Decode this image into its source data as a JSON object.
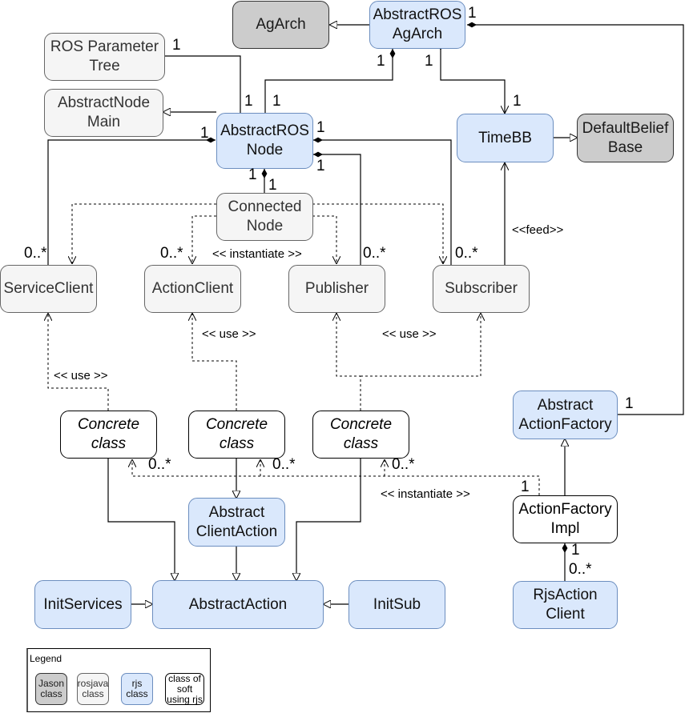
{
  "diagram": {
    "type": "uml-class-diagram",
    "colors": {
      "jason": "#cccccc",
      "rosjava": "#f5f5f5",
      "rjs": "#dae8fc",
      "soft": "#ffffff",
      "rjs_border": "#6c8ebf"
    },
    "nodes": {
      "agarch": "AgArch",
      "abstract_ros_agarch": "AbstractROS\nAgArch",
      "ros_parameter_tree": "ROS Parameter\nTree",
      "abstract_node_main": "AbstractNode\nMain",
      "abstract_ros_node": "AbstractROS\nNode",
      "timebb": "TimeBB",
      "default_belief_base": "DefaultBelief\nBase",
      "connected_node": "Connected\nNode",
      "service_client": "ServiceClient",
      "action_client": "ActionClient",
      "publisher": "Publisher",
      "subscriber": "Subscriber",
      "abstract_action_factory": "Abstract\nActionFactory",
      "concrete_class_1": "Concrete\nclass",
      "concrete_class_2": "Concrete\nclass",
      "concrete_class_3": "Concrete\nclass",
      "abstract_client_action": "Abstract\nClientAction",
      "action_factory_impl": "ActionFactory\nImpl",
      "init_services": "InitServices",
      "abstract_action": "AbstractAction",
      "init_sub": "InitSub",
      "rjs_action_client": "RjsAction\nClient"
    },
    "multiplicities": {
      "agarch_to_factory": "1",
      "agarch_node_comp": "1",
      "agarch_timebb": "1",
      "timebb_agarch": "1",
      "param_tree": "1",
      "node_param": "1",
      "node_agarch": "1",
      "node_service_client": "1",
      "node_subscriber": "1",
      "node_publisher": "1",
      "node_connected_a": "1",
      "node_connected_b": "1",
      "service_client_many": "0..*",
      "action_client_many": "0..*",
      "publisher_many": "0..*",
      "subscriber_many": "0..*",
      "factory_one": "1",
      "concrete1_many": "0..*",
      "concrete2_many": "0..*",
      "concrete3_many": "0..*",
      "impl_instantiate_one": "1",
      "impl_one": "1",
      "rjs_client_many": "0..*"
    },
    "stereotypes": {
      "instantiate_top": "<< instantiate >>",
      "feed": "<<feed>>",
      "use_action_client": "<< use >>",
      "use_pub_sub": "<< use >>",
      "use_service_client": "<< use >>",
      "instantiate_bottom": "<< instantiate >>"
    },
    "legend": {
      "title": "Legend",
      "items": [
        {
          "label": "Jason\nclass",
          "kind": "jason"
        },
        {
          "label": "rosjava\nclass",
          "kind": "rosjava"
        },
        {
          "label": "rjs\nclass",
          "kind": "rjs"
        },
        {
          "label": "class of\nsoft\nusing rjs",
          "kind": "soft"
        }
      ]
    }
  }
}
